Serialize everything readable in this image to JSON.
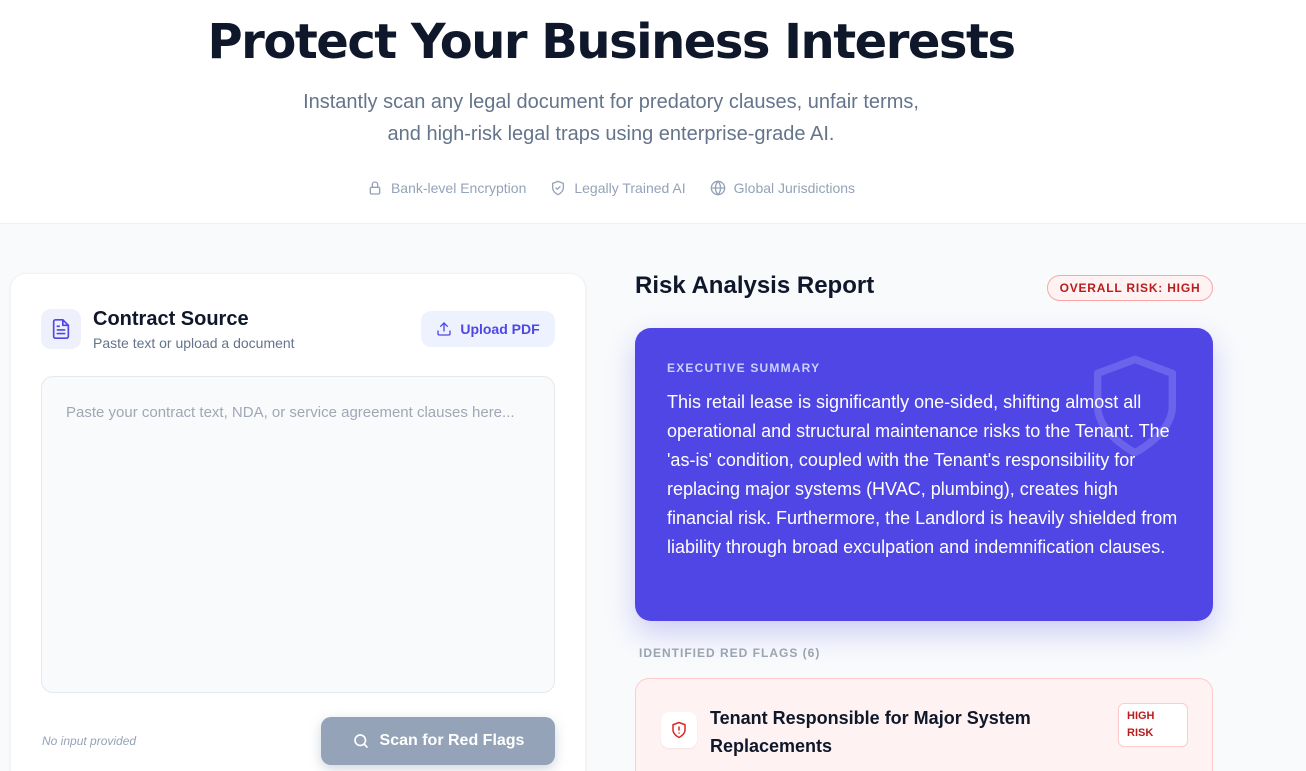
{
  "hero": {
    "title": "Protect Your Business Interests",
    "subtitle_line1": "Instantly scan any legal document for predatory clauses, unfair terms,",
    "subtitle_line2": "and high-risk legal traps using enterprise-grade AI.",
    "badges": [
      {
        "icon": "lock-icon",
        "label": "Bank-level Encryption"
      },
      {
        "icon": "shield-check-icon",
        "label": "Legally Trained AI"
      },
      {
        "icon": "globe-icon",
        "label": "Global Jurisdictions"
      }
    ]
  },
  "source": {
    "title": "Contract Source",
    "subtitle": "Paste text or upload a document",
    "upload_label": "Upload PDF",
    "placeholder": "Paste your contract text, NDA, or service agreement clauses here...",
    "status": "No input provided",
    "scan_label": "Scan for Red Flags"
  },
  "report": {
    "title": "Risk Analysis Report",
    "overall_risk": "OVERALL RISK: HIGH",
    "summary_label": "EXECUTIVE SUMMARY",
    "summary_text": "This retail lease is significantly one-sided, shifting almost all operational and structural maintenance risks to the Tenant. The 'as-is' condition, coupled with the Tenant's responsibility for replacing major systems (HVAC, plumbing), creates high financial risk. Furthermore, the Landlord is heavily shielded from liability through broad exculpation and indemnification clauses.",
    "flags_label": "IDENTIFIED RED FLAGS (6)",
    "flags": [
      {
        "title": "Tenant Responsible for Major System Replacements",
        "risk_line1": "HIGH",
        "risk_line2": "RISK"
      }
    ]
  },
  "colors": {
    "accent": "#4f46e5",
    "danger": "#b91c1c",
    "danger_bg": "#fef2f2",
    "muted": "#94a3b8"
  }
}
